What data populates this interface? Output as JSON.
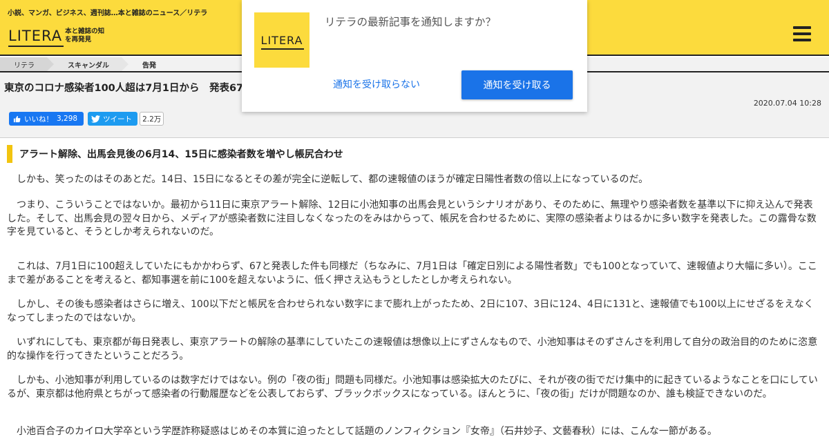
{
  "header": {
    "tagline": "小説、マンガ、ビジネス、週刊誌…本と雑誌のニュース／リテラ",
    "logo_word": "LITERA",
    "logo_sub": "本と雑誌の知を再発見"
  },
  "breadcrumb": {
    "items": [
      "リテラ",
      "スキャンダル",
      "告発"
    ]
  },
  "article": {
    "title": "東京のコロナ感染者100人超は7月1日から　発表67人",
    "date": "2020.07.04 10:28",
    "social": {
      "fb_label": "いいね！",
      "fb_count": "3,298",
      "tw_label": "ツイート",
      "tw_count": "2.2万"
    },
    "subheading": "アラート解除、出馬会見後の6月14、15日に感染者数を増やし帳尻合わせ",
    "paragraphs": [
      "しかも、笑ったのはそのあとだ。14日、15日になるとその差が完全に逆転して、都の速報値のほうが確定日陽性者数の倍以上になっているのだ。",
      "つまり、こういうことではないか。最初から11日に東京アラート解除、12日に小池知事の出馬会見というシナリオがあり、そのために、無理やり感染者数を基準以下に抑え込んで発表した。そして、出馬会見の翌々日から、メディアが感染者数に注目しなくなったのをみはからって、帳尻を合わせるために、実際の感染者よりはるかに多い数字を発表した。この露骨な数字を見ていると、そうとしか考えられないのだ。",
      "これは、7月1日に100超えしていたにもかかわらず、67と発表した件も同様だ（ちなみに、7月1日は「確定日別による陽性者数」でも100となっていて、速報値より大幅に多い）。ここまで差があることを考えると、都知事選を前に100を超えないように、低く押さえ込もうとしたとしか考えられない。",
      "しかし、その後も感染者はさらに増え、100以下だと帳尻を合わせられない数字にまで膨れ上がったため、2日に107、3日に124、4日に131と、速報値でも100以上にせざるをえなくなってしまったのではないか。",
      "いずれにしても、東京都が毎日発表し、東京アラートの解除の基準にしていたこの速報値は想像以上にずさんなもので、小池知事はそのずさんさを利用して自分の政治目的のために恣意的な操作を行ってきたということだろう。",
      "しかも、小池知事が利用しているのは数字だけではない。例の「夜の街」問題も同様だ。小池知事は感染拡大のたびに、それが夜の街でだけ集中的に起きているようなことを口にしているが、東京都は他府県とちがって感染者の行動履歴などを公表しておらず、ブラックボックスになっている。ほんとうに、「夜の街」だけが問題なのか、誰も検証できないのだ。",
      "小池百合子のカイロ大学卒という学歴詐称疑惑はじめその本質に迫ったとして話題のノンフィクション『女帝』（石井妙子、文藝春秋）には、こんな一節がある。"
    ]
  },
  "popup": {
    "message": "リテラの最新記事を通知しますか？",
    "decline_label": "通知を受け取らない",
    "accept_label": "通知を受け取る"
  },
  "colors": {
    "brand_yellow": "#fcdb3d",
    "accent_bar": "#f2c40f",
    "button_blue": "#1a73e8",
    "facebook_blue": "#1877f2",
    "twitter_blue": "#1d9bf0"
  },
  "icons": {
    "menu": "hamburger-icon",
    "facebook": "facebook-thumb-icon",
    "twitter": "twitter-bird-icon"
  }
}
